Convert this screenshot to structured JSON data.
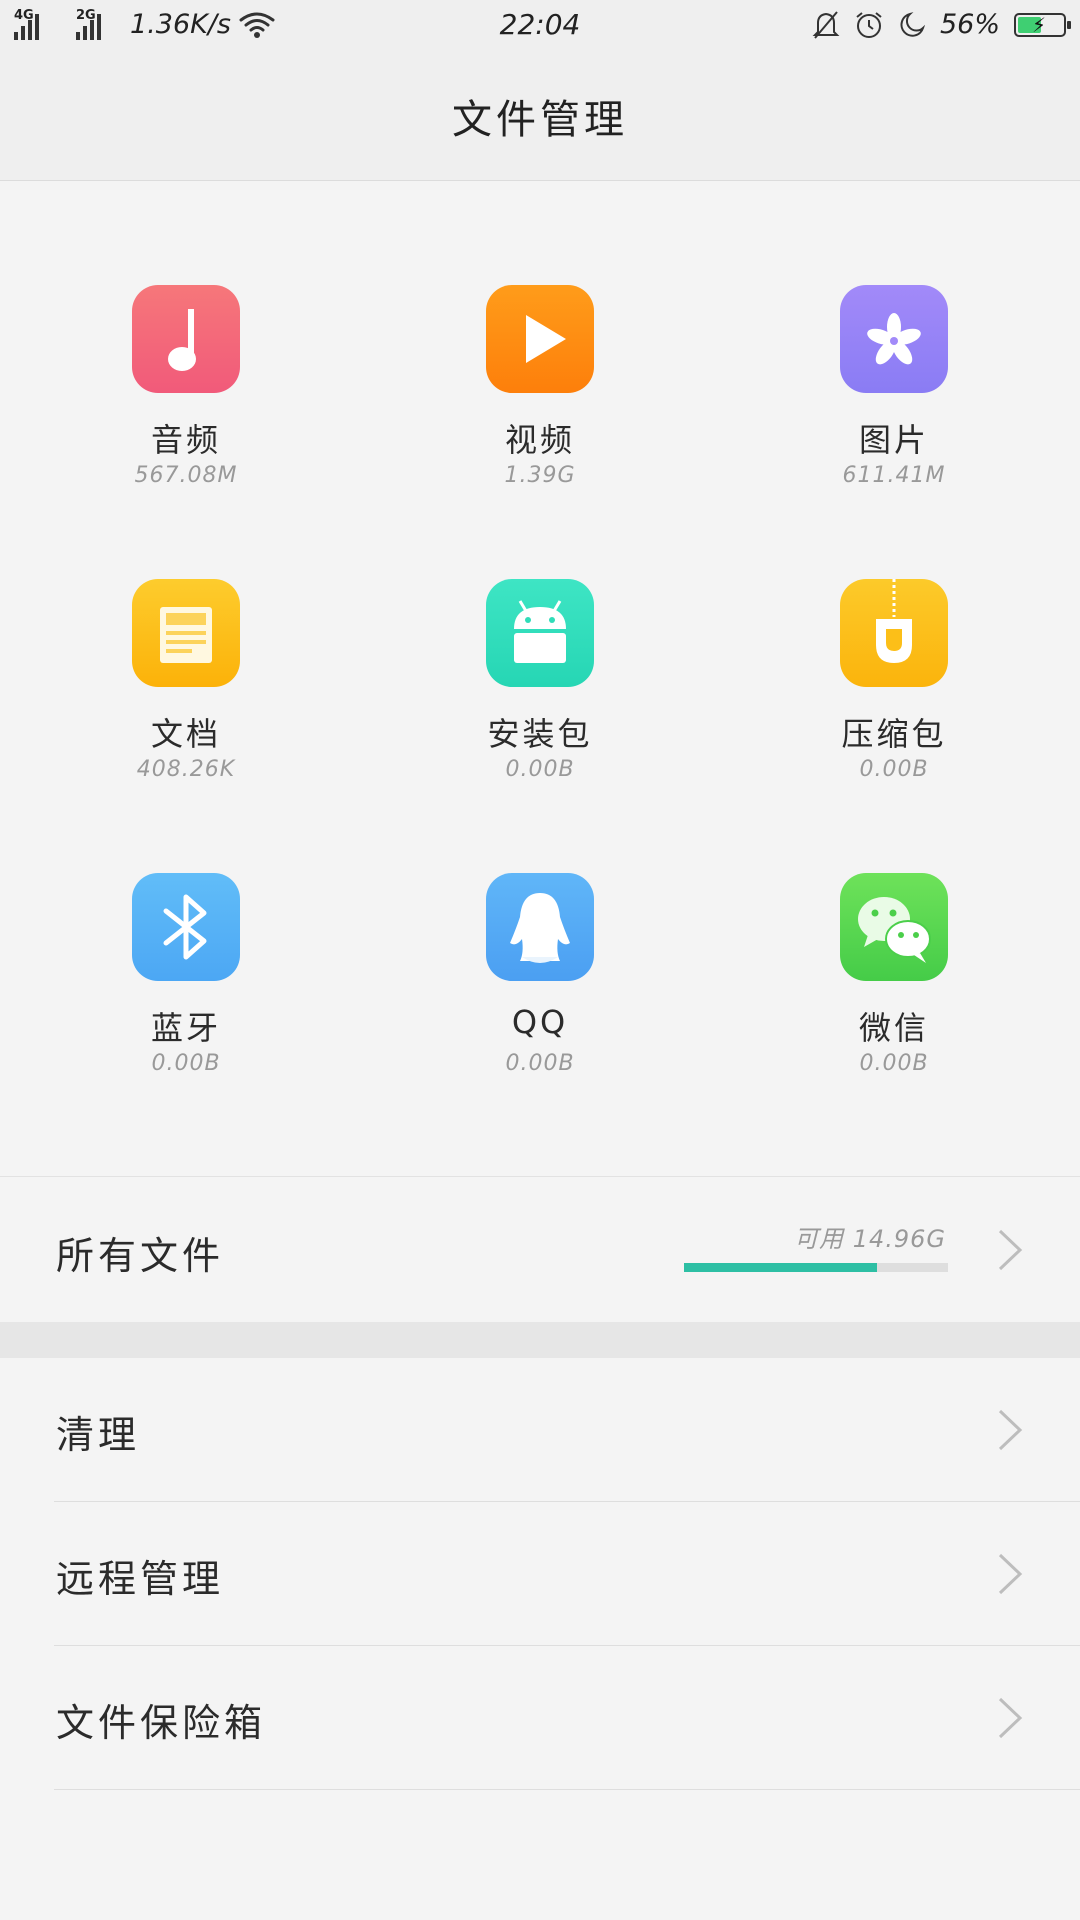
{
  "status_bar": {
    "network_1": "4G",
    "network_2": "2G",
    "speed": "1.36K/s",
    "time": "22:04",
    "battery_percent": "56%",
    "battery_level": 0.56,
    "icons": [
      "signal-icon",
      "wifi-icon",
      "bell-off-icon",
      "alarm-icon",
      "moon-icon",
      "battery-icon"
    ]
  },
  "header": {
    "title": "文件管理"
  },
  "categories": [
    {
      "label": "音频",
      "size": "567.08M",
      "icon": "music-note-icon",
      "color_top": "#f6777a",
      "color_bottom": "#f15a7a"
    },
    {
      "label": "视频",
      "size": "1.39G",
      "icon": "play-icon",
      "color_top": "#ff9c1a",
      "color_bottom": "#fd7f0b"
    },
    {
      "label": "图片",
      "size": "611.41M",
      "icon": "flower-icon",
      "color_top": "#a28af9",
      "color_bottom": "#8a7cf4"
    },
    {
      "label": "文档",
      "size": "408.26K",
      "icon": "document-icon",
      "color_top": "#fdcc2d",
      "color_bottom": "#fcb209"
    },
    {
      "label": "安装包",
      "size": "0.00B",
      "icon": "android-icon",
      "color_top": "#3ee5c4",
      "color_bottom": "#26d6b4"
    },
    {
      "label": "压缩包",
      "size": "0.00B",
      "icon": "zip-icon",
      "color_top": "#fcca2a",
      "color_bottom": "#fbb40c"
    },
    {
      "label": "蓝牙",
      "size": "0.00B",
      "icon": "bluetooth-icon",
      "color_top": "#61bdf8",
      "color_bottom": "#4ca7f4"
    },
    {
      "label": "QQ",
      "size": "0.00B",
      "icon": "penguin-icon",
      "color_top": "#60b6f8",
      "color_bottom": "#4b9ff2"
    },
    {
      "label": "微信",
      "size": "0.00B",
      "icon": "wechat-icon",
      "color_top": "#6ee25a",
      "color_bottom": "#45cc48"
    }
  ],
  "all_files": {
    "label": "所有文件",
    "available": "可用 14.96G",
    "used_fraction": 0.73,
    "accent": "#2dbfa4"
  },
  "menu": [
    {
      "label": "清理"
    },
    {
      "label": "远程管理"
    },
    {
      "label": "文件保险箱"
    }
  ]
}
